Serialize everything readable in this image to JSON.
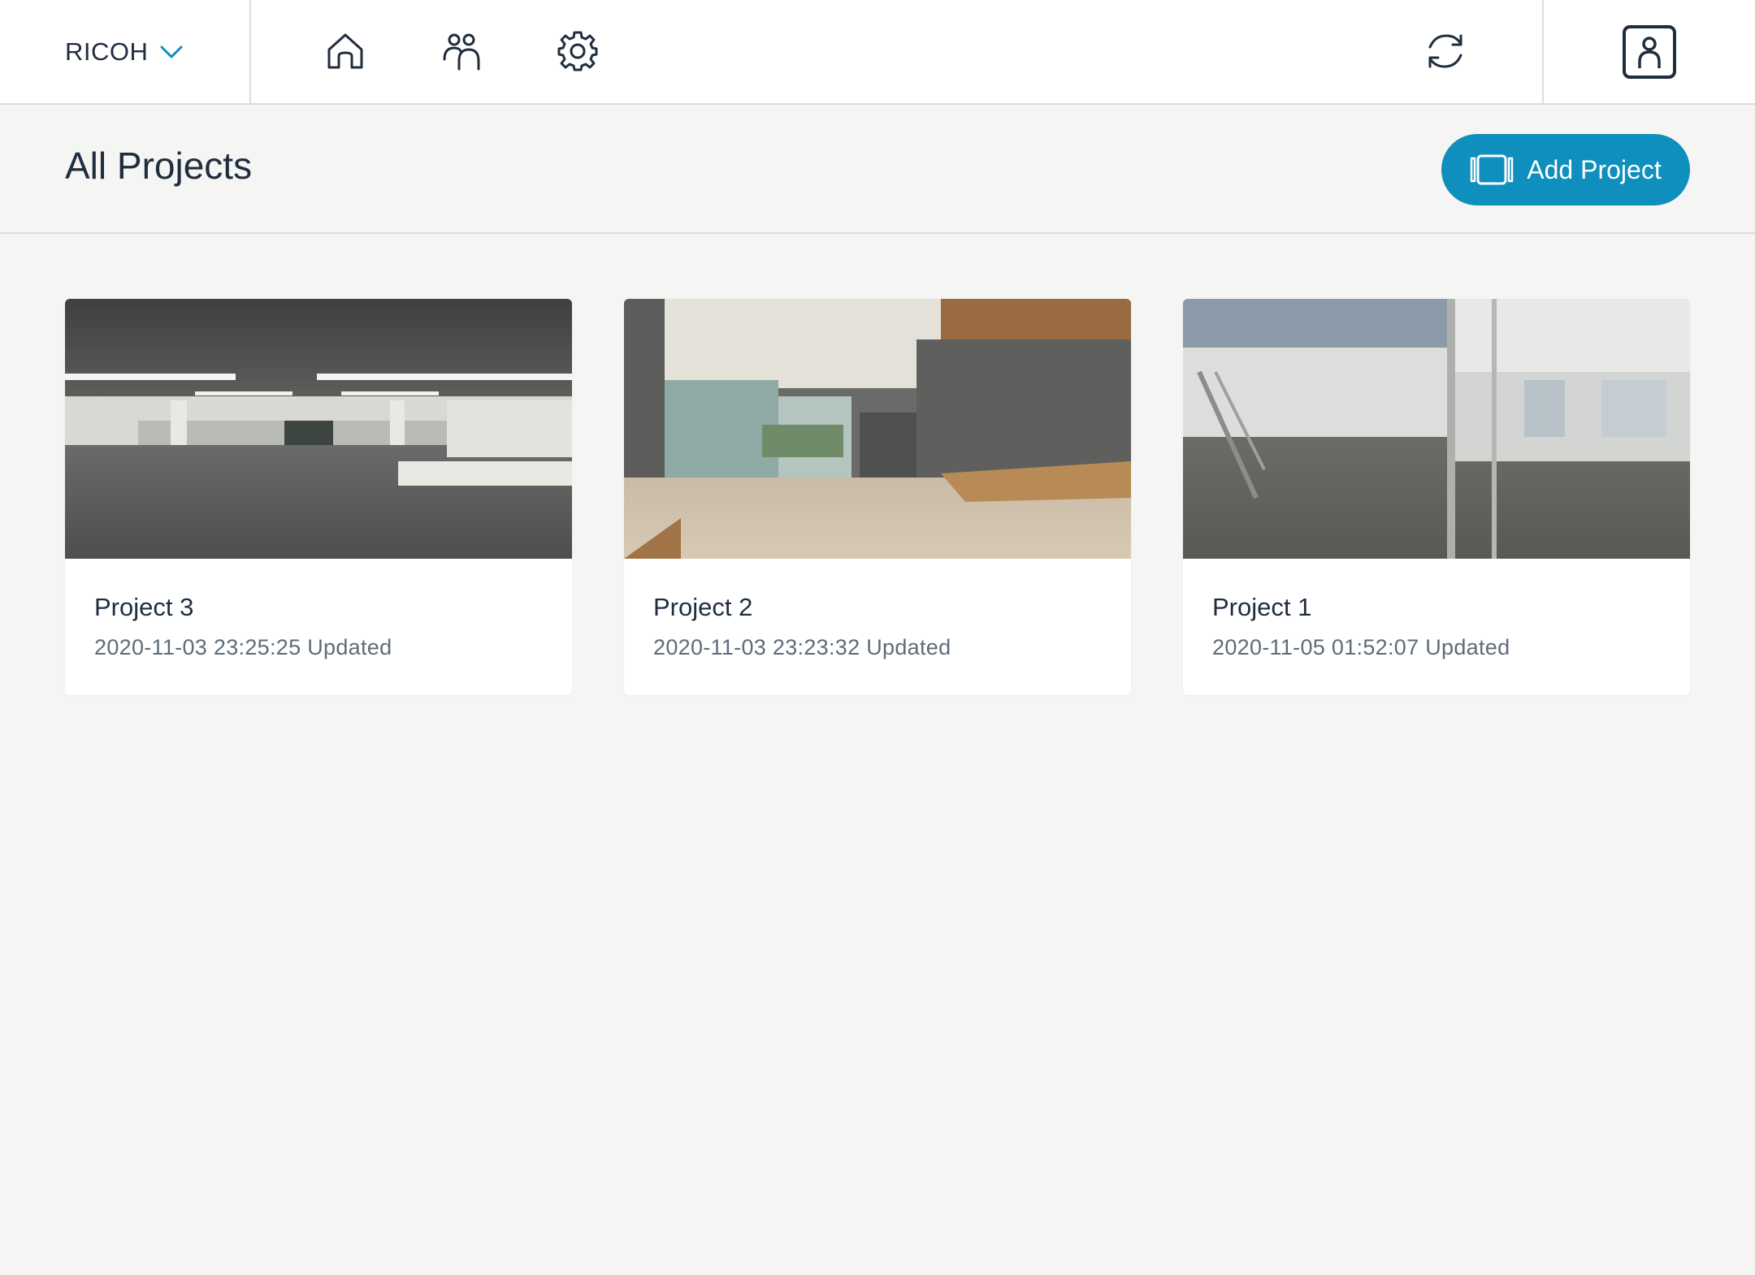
{
  "topbar": {
    "org_name": "RICOH",
    "icons": [
      "chevron-down-icon",
      "home-icon",
      "users-icon",
      "gear-icon",
      "sync-icon",
      "user-profile-icon"
    ]
  },
  "header": {
    "title": "All Projects",
    "add_button_label": "Add Project",
    "add_button_icon": "panorama-icon"
  },
  "projects": [
    {
      "name": "Project 3",
      "updated": "2020-11-03 23:25:25 Updated"
    },
    {
      "name": "Project 2",
      "updated": "2020-11-03 23:23:32 Updated"
    },
    {
      "name": "Project 1",
      "updated": "2020-11-05 01:52:07 Updated"
    }
  ],
  "colors": {
    "accent": "#0e8fbd",
    "background": "#f5f5f4",
    "text": "#1f2d3d",
    "subtext": "#5f6b78"
  }
}
